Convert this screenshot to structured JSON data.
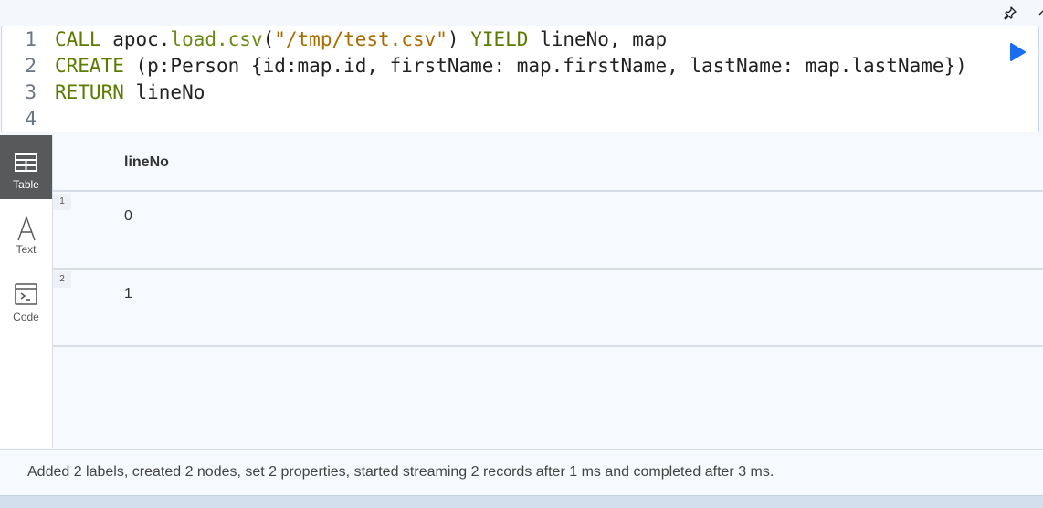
{
  "toolbar": {
    "pin_icon": "pin-icon",
    "collapse_icon": "chevron-up-icon"
  },
  "editor": {
    "lines": [
      {
        "number": "1",
        "tokens": [
          {
            "type": "kw",
            "text": "CALL"
          },
          {
            "type": "txt",
            "text": " apoc."
          },
          {
            "type": "fn",
            "text": "load.csv"
          },
          {
            "type": "txt",
            "text": "("
          },
          {
            "type": "str",
            "text": "\"/tmp/test.csv\""
          },
          {
            "type": "txt",
            "text": ") "
          },
          {
            "type": "kw",
            "text": "YIELD"
          },
          {
            "type": "txt",
            "text": " lineNo, map"
          }
        ]
      },
      {
        "number": "2",
        "tokens": [
          {
            "type": "kw",
            "text": "CREATE"
          },
          {
            "type": "txt",
            "text": " (p:Person {id:map.id, firstName: map.firstName, lastName: map.lastName})"
          }
        ]
      },
      {
        "number": "3",
        "tokens": [
          {
            "type": "kw",
            "text": "RETURN"
          },
          {
            "type": "txt",
            "text": " lineNo"
          }
        ]
      },
      {
        "number": "4",
        "tokens": []
      }
    ],
    "run_icon": "play-icon",
    "accent_color": "#1a6cf0"
  },
  "sidebar": {
    "items": [
      {
        "label": "Table",
        "icon": "table-icon",
        "active": true
      },
      {
        "label": "Text",
        "icon": "text-icon",
        "active": false
      },
      {
        "label": "Code",
        "icon": "terminal-icon",
        "active": false
      }
    ]
  },
  "table": {
    "columns": [
      "lineNo"
    ],
    "rows": [
      {
        "index": "1",
        "values": [
          "0"
        ]
      },
      {
        "index": "2",
        "values": [
          "1"
        ]
      }
    ]
  },
  "footer": {
    "summary": "Added 2 labels, created 2 nodes, set 2 properties, started streaming 2 records after 1 ms and completed after 3 ms."
  }
}
